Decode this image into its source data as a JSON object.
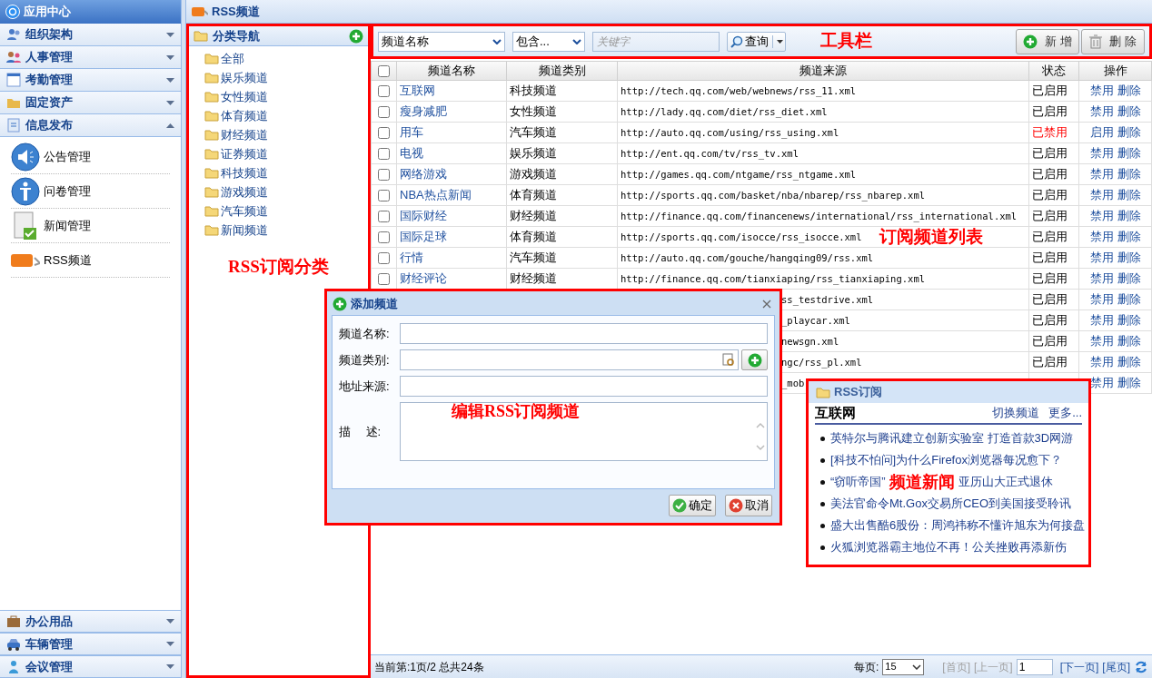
{
  "app_header": {
    "title": "应用中心"
  },
  "sidebar": {
    "sections": [
      {
        "label": "组织架构",
        "expanded": false
      },
      {
        "label": "人事管理",
        "expanded": false
      },
      {
        "label": "考勤管理",
        "expanded": false
      },
      {
        "label": "固定资产",
        "expanded": false
      },
      {
        "label": "信息发布",
        "expanded": true,
        "items": [
          {
            "label": "公告管理"
          },
          {
            "label": "问卷管理"
          },
          {
            "label": "新闻管理"
          },
          {
            "label": "RSS频道"
          }
        ]
      }
    ],
    "bottom_sections": [
      {
        "label": "办公用品",
        "expanded": false
      },
      {
        "label": "车辆管理",
        "expanded": false
      },
      {
        "label": "会议管理",
        "expanded": false
      }
    ]
  },
  "page_title": "RSS频道",
  "category_panel": {
    "title": "分类导航",
    "items": [
      "全部",
      "娱乐频道",
      "女性频道",
      "体育频道",
      "财经频道",
      "证券频道",
      "科技频道",
      "游戏频道",
      "汽车频道",
      "新闻频道"
    ],
    "annotation": "RSS订阅分类"
  },
  "toolbar": {
    "field_select": "频道名称",
    "operator_select": "包含...",
    "keyword_placeholder": "关键字",
    "query_button": "查询",
    "buttons": [
      {
        "kind": "add",
        "label": "新 增"
      },
      {
        "kind": "delete",
        "label": "删 除"
      }
    ],
    "annotation": "工具栏"
  },
  "table": {
    "select_all_checked": false,
    "columns": [
      "频道名称",
      "频道类别",
      "频道来源",
      "状态",
      "操作"
    ],
    "annotation": "订阅频道列表",
    "rows": [
      {
        "kind": "full",
        "checked": false,
        "name": "互联网",
        "category": "科技频道",
        "url": "http://tech.qq.com/web/webnews/rss_11.xml",
        "status": "已启用",
        "enabled": true,
        "actions": [
          "禁用",
          "删除"
        ]
      },
      {
        "kind": "full",
        "checked": false,
        "name": "瘦身减肥",
        "category": "女性频道",
        "url": "http://lady.qq.com/diet/rss_diet.xml",
        "status": "已启用",
        "enabled": true,
        "actions": [
          "禁用",
          "删除"
        ]
      },
      {
        "kind": "full",
        "checked": false,
        "name": "用车",
        "category": "汽车频道",
        "url": "http://auto.qq.com/using/rss_using.xml",
        "status": "已禁用",
        "enabled": false,
        "actions": [
          "启用",
          "删除"
        ]
      },
      {
        "kind": "full",
        "checked": false,
        "name": "电视",
        "category": "娱乐频道",
        "url": "http://ent.qq.com/tv/rss_tv.xml",
        "status": "已启用",
        "enabled": true,
        "actions": [
          "禁用",
          "删除"
        ]
      },
      {
        "kind": "full",
        "checked": false,
        "name": "网络游戏",
        "category": "游戏频道",
        "url": "http://games.qq.com/ntgame/rss_ntgame.xml",
        "status": "已启用",
        "enabled": true,
        "actions": [
          "禁用",
          "删除"
        ]
      },
      {
        "kind": "full",
        "checked": false,
        "name": "NBA热点新闻",
        "category": "体育频道",
        "url": "http://sports.qq.com/basket/nba/nbarep/rss_nbarep.xml",
        "status": "已启用",
        "enabled": true,
        "actions": [
          "禁用",
          "删除"
        ]
      },
      {
        "kind": "full",
        "checked": false,
        "name": "国际财经",
        "category": "财经频道",
        "url": "http://finance.qq.com/financenews/international/rss_international.xml",
        "status": "已启用",
        "enabled": true,
        "actions": [
          "禁用",
          "删除"
        ]
      },
      {
        "kind": "full",
        "checked": false,
        "name": "国际足球",
        "category": "体育频道",
        "url": "http://sports.qq.com/isocce/rss_isocce.xml",
        "status": "已启用",
        "enabled": true,
        "actions": [
          "禁用",
          "删除"
        ]
      },
      {
        "kind": "full",
        "checked": false,
        "name": "行情",
        "category": "汽车频道",
        "url": "http://auto.qq.com/gouche/hangqing09/rss.xml",
        "status": "已启用",
        "enabled": true,
        "actions": [
          "禁用",
          "删除"
        ]
      },
      {
        "kind": "full",
        "checked": false,
        "name": "财经评论",
        "category": "财经频道",
        "url": "http://finance.qq.com/tianxiaping/rss_tianxiaping.xml",
        "status": "已启用",
        "enabled": true,
        "actions": [
          "禁用",
          "删除"
        ]
      },
      {
        "kind": "covered",
        "url": "ss_testdrive.xml",
        "status": "已启用",
        "enabled": true,
        "actions": [
          "禁用",
          "删除"
        ]
      },
      {
        "kind": "covered",
        "url": "_playcar.xml",
        "status": "已启用",
        "enabled": true,
        "actions": [
          "禁用",
          "删除"
        ]
      },
      {
        "kind": "covered",
        "url": "newsgn.xml",
        "status": "已启用",
        "enabled": true,
        "actions": [
          "禁用",
          "删除"
        ]
      },
      {
        "kind": "covered",
        "url": "ngc/rss_pl.xml",
        "status": "已启用",
        "enabled": true,
        "actions": [
          "禁用",
          "删除"
        ]
      },
      {
        "kind": "covered",
        "url": "_mob",
        "actions": [
          "禁用",
          "删除"
        ]
      }
    ]
  },
  "pager": {
    "summary": "当前第:1页/2 总共24条",
    "page_size_label": "每页:",
    "page_size": "15",
    "links": [
      {
        "label": "[首页]",
        "disabled": true
      },
      {
        "label": "[上一页]",
        "disabled": true
      },
      {
        "kind": "input",
        "label": "1"
      },
      {
        "label": "[下一页]",
        "disabled": false
      },
      {
        "label": "[尾页]",
        "disabled": false
      }
    ]
  },
  "dialog": {
    "title": "添加频道",
    "fields": [
      {
        "kind": "text",
        "label": "频道名称:"
      },
      {
        "kind": "lookup",
        "label": "频道类别:"
      },
      {
        "kind": "text",
        "label": "地址来源:"
      },
      {
        "kind": "textarea",
        "label": "描　 述:"
      }
    ],
    "annotation": "编辑RSS订阅频道",
    "buttons": [
      {
        "kind": "ok",
        "label": "确定"
      },
      {
        "kind": "cancel",
        "label": "取消"
      }
    ]
  },
  "rss_widget": {
    "title": "RSS订阅",
    "channel": "互联网",
    "links": [
      "切换频道",
      "更多..."
    ],
    "items": [
      {
        "segments": [
          "英特尔与腾讯建立创新实验室  打造首款3D网游"
        ]
      },
      {
        "segments": [
          "[科技不怕问]为什么Firefox浏览器每况愈下？"
        ]
      },
      {
        "segments": [
          "“窃听帝国”",
          "亚历山大正式退休"
        ],
        "overlay": "频道新闻"
      },
      {
        "segments": [
          "美法官命令Mt.Gox交易所CEO到美国接受聆讯"
        ]
      },
      {
        "segments": [
          "盛大出售酷6股份：周鸿祎称不懂许旭东为何接盘"
        ]
      },
      {
        "segments": [
          "火狐浏览器霸主地位不再！公关挫败再添新伤"
        ]
      }
    ]
  }
}
